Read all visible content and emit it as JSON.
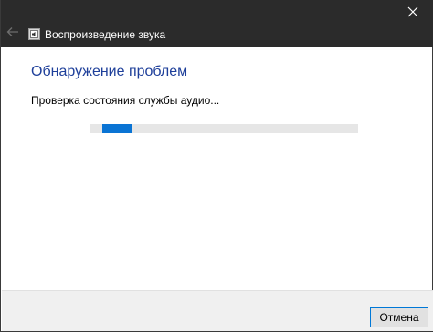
{
  "window": {
    "title": "Воспроизведение звука",
    "app_icon": "speaker-icon",
    "back_icon": "back-arrow-icon",
    "close_icon": "close-icon"
  },
  "main": {
    "heading": "Обнаружение проблем",
    "status": "Проверка состояния службы аудио..."
  },
  "progress": {
    "style": "indeterminate",
    "color": "#0a74d4"
  },
  "footer": {
    "cancel_label": "Отмена"
  },
  "colors": {
    "titlebar": "#2b2b2b",
    "heading": "#1e3f9a",
    "accent": "#0078d7"
  }
}
